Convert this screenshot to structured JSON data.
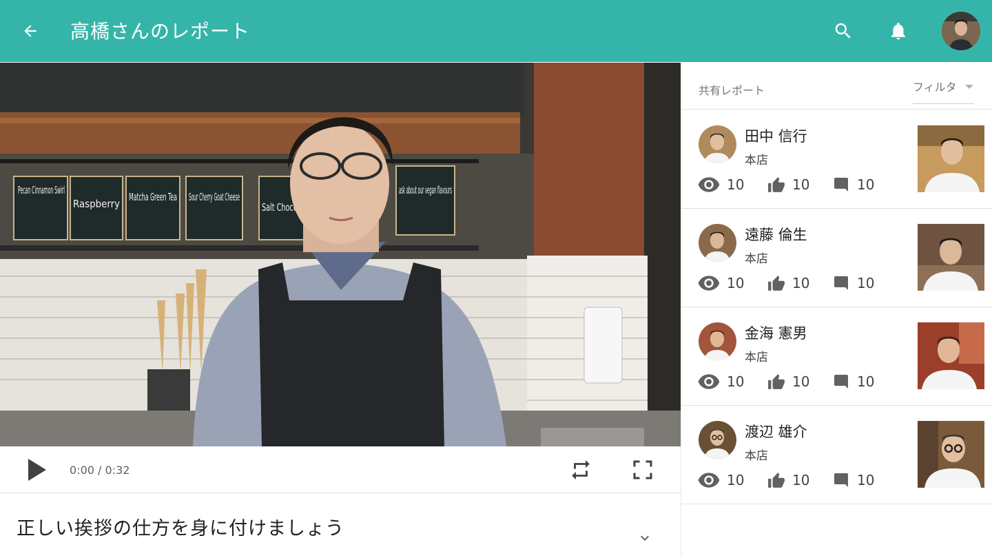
{
  "header": {
    "title": "高橋さんのレポート",
    "back_icon": "arrow-back-icon",
    "search_icon": "search-icon",
    "notification_icon": "bell-icon",
    "accent_color": "#35b5aa"
  },
  "video": {
    "menu_signs": [
      "Pecan Cinnamon Swirl",
      "Raspberry",
      "Matcha Green Tea",
      "Sour Cherry Goat Cheese",
      "Salt Chocolat",
      "ask about our vegan flavours"
    ],
    "current_time": "0:00 / 0:32",
    "play_icon": "play-icon",
    "loop_icon": "repeat-icon",
    "fullscreen_icon": "fullscreen-icon"
  },
  "description": {
    "title": "正しい挨拶の仕方を身に付けましょう",
    "expand_icon": "chevron-down-icon"
  },
  "side_panel": {
    "label": "共有レポート",
    "filter_label": "フィルタ",
    "reports": [
      {
        "name": "田中 信行",
        "store": "本店",
        "views": "10",
        "likes": "10",
        "comments": "10"
      },
      {
        "name": "遠藤 倫生",
        "store": "本店",
        "views": "10",
        "likes": "10",
        "comments": "10"
      },
      {
        "name": "金海 憲男",
        "store": "本店",
        "views": "10",
        "likes": "10",
        "comments": "10"
      },
      {
        "name": "渡辺 雄介",
        "store": "本店",
        "views": "10",
        "likes": "10",
        "comments": "10"
      }
    ]
  }
}
